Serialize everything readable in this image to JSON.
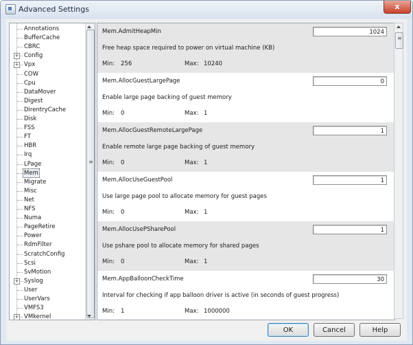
{
  "window": {
    "title": "Advanced Settings",
    "close_label": "x"
  },
  "tree": {
    "items": [
      {
        "label": "Annotations",
        "expandable": false
      },
      {
        "label": "BufferCache",
        "expandable": false
      },
      {
        "label": "CBRC",
        "expandable": false
      },
      {
        "label": "Config",
        "expandable": true
      },
      {
        "label": "Vpx",
        "expandable": true
      },
      {
        "label": "COW",
        "expandable": false
      },
      {
        "label": "Cpu",
        "expandable": false
      },
      {
        "label": "DataMover",
        "expandable": false
      },
      {
        "label": "Digest",
        "expandable": false
      },
      {
        "label": "DirentryCache",
        "expandable": false
      },
      {
        "label": "Disk",
        "expandable": false
      },
      {
        "label": "FSS",
        "expandable": false
      },
      {
        "label": "FT",
        "expandable": false
      },
      {
        "label": "HBR",
        "expandable": false
      },
      {
        "label": "Irq",
        "expandable": false
      },
      {
        "label": "LPage",
        "expandable": false
      },
      {
        "label": "Mem",
        "expandable": false,
        "selected": true
      },
      {
        "label": "Migrate",
        "expandable": false
      },
      {
        "label": "Misc",
        "expandable": false
      },
      {
        "label": "Net",
        "expandable": false
      },
      {
        "label": "NFS",
        "expandable": false
      },
      {
        "label": "Numa",
        "expandable": false
      },
      {
        "label": "PageRetire",
        "expandable": false
      },
      {
        "label": "Power",
        "expandable": false
      },
      {
        "label": "RdmFilter",
        "expandable": false
      },
      {
        "label": "ScratchConfig",
        "expandable": false
      },
      {
        "label": "Scsi",
        "expandable": false
      },
      {
        "label": "SvMotion",
        "expandable": false
      },
      {
        "label": "Syslog",
        "expandable": true
      },
      {
        "label": "User",
        "expandable": false
      },
      {
        "label": "UserVars",
        "expandable": false
      },
      {
        "label": "VMFS3",
        "expandable": false
      },
      {
        "label": "VMkernel",
        "expandable": true
      }
    ]
  },
  "settings": {
    "min_label": "Min:",
    "max_label": "Max:",
    "rows": [
      {
        "name": "Mem.AdmitHeapMin",
        "value": "1024",
        "description": "Free heap space required to power on virtual machine (KB)",
        "min": "256",
        "max": "10240",
        "shaded": true
      },
      {
        "name": "Mem.AllocGuestLargePage",
        "value": "0",
        "description": "Enable large page backing of guest memory",
        "min": "0",
        "max": "1",
        "shaded": false
      },
      {
        "name": "Mem.AllocGuestRemoteLargePage",
        "value": "1",
        "description": "Enable remote large page backing of guest memory",
        "min": "0",
        "max": "1",
        "shaded": true
      },
      {
        "name": "Mem.AllocUseGuestPool",
        "value": "1",
        "description": "Use large page pool to allocate memory for guest pages",
        "min": "0",
        "max": "1",
        "shaded": false
      },
      {
        "name": "Mem.AllocUsePSharePool",
        "value": "1",
        "description": "Use pshare pool to allocate memory for shared pages",
        "min": "0",
        "max": "1",
        "shaded": true
      },
      {
        "name": "Mem.AppBalloonCheckTime",
        "value": "30",
        "description": "Interval for checking if app balloon driver is active (in seconds of guest progress)",
        "min": "1",
        "max": "1000000",
        "shaded": false
      }
    ]
  },
  "buttons": {
    "ok": "OK",
    "cancel": "Cancel",
    "help": "Help"
  }
}
